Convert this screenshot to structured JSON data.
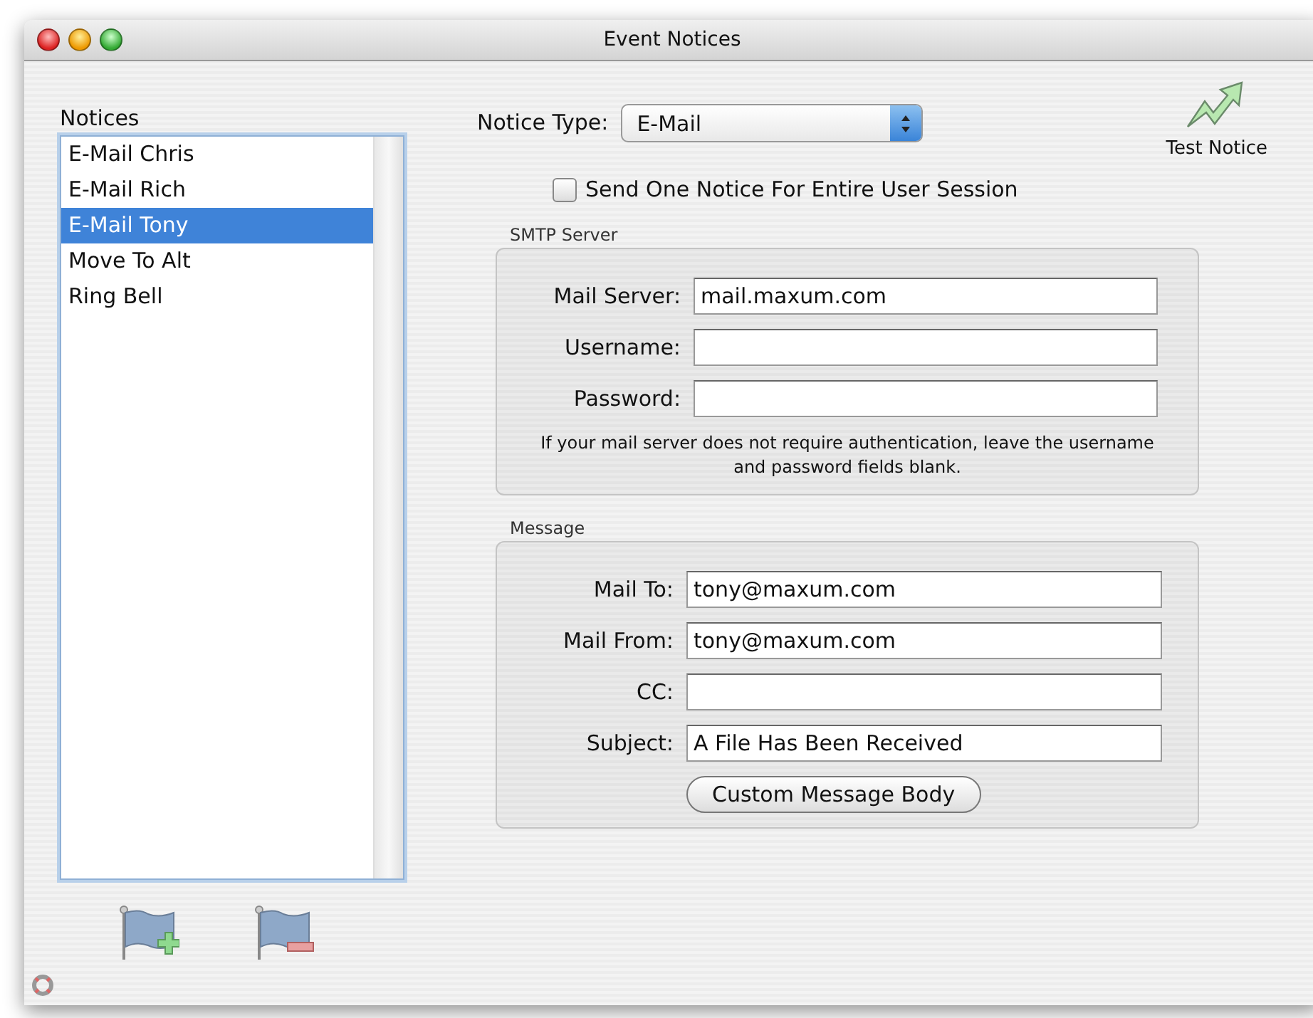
{
  "window": {
    "title": "Event Notices"
  },
  "notices": {
    "label": "Notices",
    "items": [
      {
        "label": "E-Mail Chris",
        "selected": false
      },
      {
        "label": "E-Mail Rich",
        "selected": false
      },
      {
        "label": "E-Mail Tony",
        "selected": true
      },
      {
        "label": "Move To Alt",
        "selected": false
      },
      {
        "label": "Ring Bell",
        "selected": false
      }
    ]
  },
  "notice_type": {
    "label": "Notice Type:",
    "value": "E-Mail"
  },
  "test_notice": {
    "label": "Test Notice"
  },
  "session_checkbox": {
    "label": "Send One Notice For Entire User Session",
    "checked": false
  },
  "smtp_server": {
    "title": "SMTP Server",
    "fields": [
      {
        "label": "Mail Server:",
        "value": "mail.maxum.com"
      },
      {
        "label": "Username:"
      },
      {
        "label": "Password:"
      }
    ],
    "note": "If your mail server does not require authentication, leave the username and password fields blank."
  },
  "message": {
    "title": "Message",
    "fields": [
      {
        "label": "Mail To:",
        "value": "tony@maxum.com"
      },
      {
        "label": "Mail From:",
        "value": "tony@maxum.com"
      },
      {
        "label": "CC:"
      },
      {
        "label": "Subject:",
        "value": "A File Has Been Received"
      }
    ],
    "button": "Custom Message Body"
  }
}
